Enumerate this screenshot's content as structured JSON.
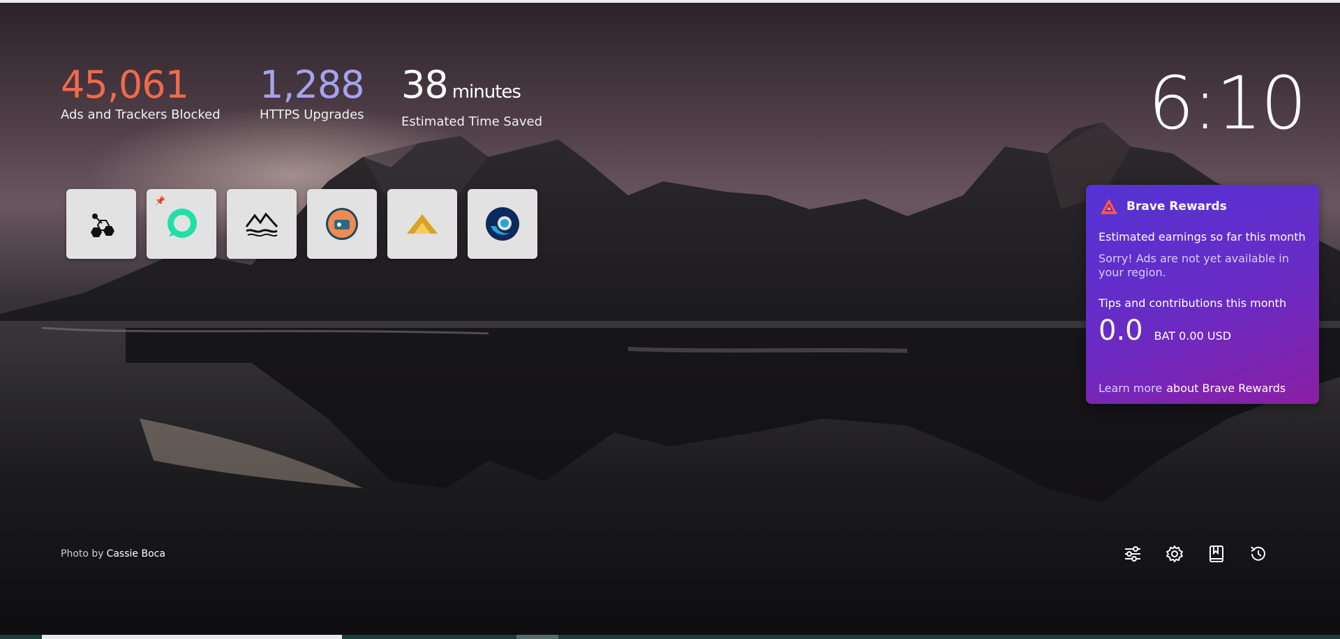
{
  "stats": {
    "ads_blocked": {
      "value": "45,061",
      "label": "Ads and Trackers Blocked"
    },
    "https_upgrades": {
      "value": "1,288",
      "label": "HTTPS Upgrades"
    },
    "time_saved": {
      "value": "38",
      "unit": "minutes",
      "label": "Estimated Time Saved"
    }
  },
  "clock": "6:10",
  "top_sites": [
    {
      "icon": "hexagon-molecule-icon",
      "pinned": false
    },
    {
      "icon": "green-chat-bubble-icon",
      "pinned": true
    },
    {
      "icon": "mountain-waves-icon",
      "pinned": false
    },
    {
      "icon": "orange-circle-logo-icon",
      "pinned": false
    },
    {
      "icon": "gold-mountain-icon",
      "pinned": false
    },
    {
      "icon": "blue-swirl-logo-icon",
      "pinned": false
    }
  ],
  "rewards": {
    "title": "Brave Rewards",
    "earnings_label": "Estimated earnings so far this month",
    "earnings_note": "Sorry! Ads are not yet available in your region.",
    "tips_label": "Tips and contributions this month",
    "balance": "0.0",
    "balance_detail": "BAT 0.00 USD",
    "learn_more_link": "Learn more",
    "learn_more_text": "about Brave Rewards",
    "accent": "#5433d6"
  },
  "photo_credit": {
    "prefix": "Photo by",
    "author": "Cassie Boca"
  },
  "actions": [
    {
      "icon": "sliders-icon"
    },
    {
      "icon": "gear-icon"
    },
    {
      "icon": "bookmarks-icon"
    },
    {
      "icon": "history-icon"
    }
  ]
}
